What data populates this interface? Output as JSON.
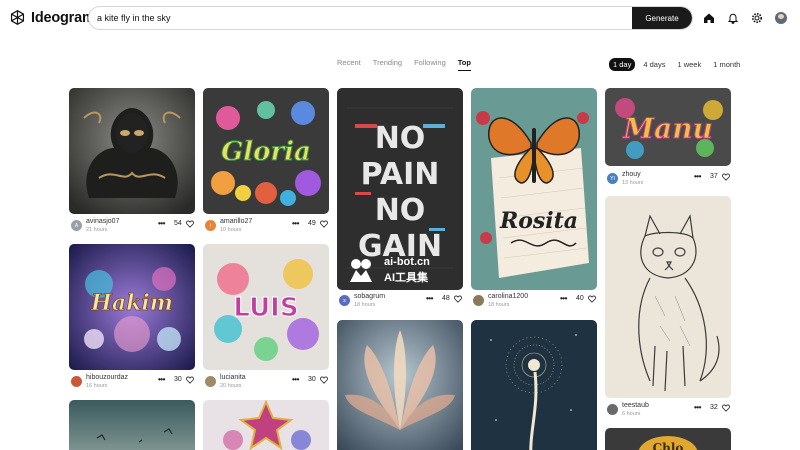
{
  "app": {
    "name": "Ideogram"
  },
  "search": {
    "value": "a kite fly in the sky",
    "button": "Generate"
  },
  "header_icons": [
    "home-icon",
    "bell-icon",
    "gear-icon"
  ],
  "tabs": [
    {
      "label": "Recent",
      "active": false
    },
    {
      "label": "Trending",
      "active": false
    },
    {
      "label": "Following",
      "active": false
    },
    {
      "label": "Top",
      "active": true
    }
  ],
  "ranges": [
    {
      "label": "1 day",
      "active": true
    },
    {
      "label": "4 days",
      "active": false
    },
    {
      "label": "1 week",
      "active": false
    },
    {
      "label": "1 month",
      "active": false
    }
  ],
  "posts": [
    {
      "image": "dark-masked-figure",
      "user": "avinasjo07",
      "time": "21 hours",
      "likes": "54",
      "avatar_letter": "A",
      "avatar_color": "#9aa0a6"
    },
    {
      "image": "Gloria",
      "user": "amarillo27",
      "time": "10 hours",
      "likes": "49",
      "avatar_letter": "i",
      "avatar_color": "#e8843a"
    },
    {
      "image": "NO PAIN NO GAIN",
      "user": "sobagrum",
      "time": "18 hours",
      "likes": "48",
      "avatar_letter": "s",
      "avatar_color": "#5b6bbf"
    },
    {
      "image": "Rosita",
      "user": "carolina1200",
      "time": "18 hours",
      "likes": "40",
      "avatar_letter": "",
      "avatar_color": "#8a7a5a"
    },
    {
      "image": "Manu",
      "user": "zhouy",
      "time": "13 hours",
      "likes": "37",
      "avatar_letter": "YI",
      "avatar_color": "#4a7fc0"
    },
    {
      "image": "Hakim",
      "user": "hibouzourdaz",
      "time": "16 hours",
      "likes": "30",
      "avatar_letter": "",
      "avatar_color": "#c85a3a"
    },
    {
      "image": "LUIS",
      "user": "lucianita",
      "time": "20 hours",
      "likes": "30",
      "avatar_letter": "",
      "avatar_color": "#a08a6a"
    },
    {
      "image": "cat-sketch",
      "user": "teestaub",
      "time": "6 hours",
      "likes": "32",
      "avatar_letter": "",
      "avatar_color": "#6a6a6a"
    }
  ],
  "watermark": {
    "line1": "ai-bot.cn",
    "line2": "AI工具集"
  },
  "colors": {
    "accent": "#111111",
    "background": "#ffffff"
  }
}
